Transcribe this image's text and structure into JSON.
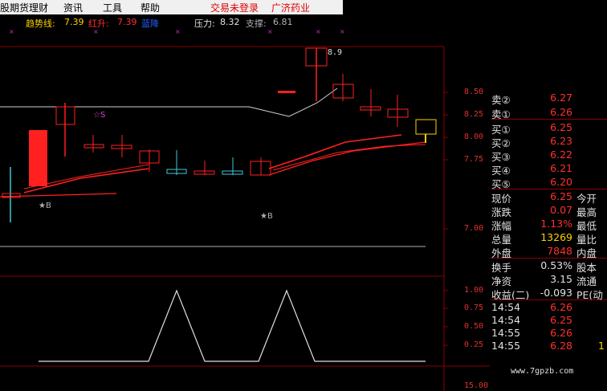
{
  "menubar": {
    "items": [
      "股期货理财",
      "资讯",
      "工具",
      "帮助"
    ],
    "login_status": "交易未登录",
    "stock_name": "广济药业"
  },
  "indicators": {
    "trend_label": "趋势线:",
    "trend_value": "7.39",
    "red_up_label": "红升:",
    "red_up_value": "7.39",
    "blue_down_label": "蓝降",
    "pressure_label": "压力:",
    "pressure_value": "8.32",
    "support_label": "支撑:",
    "support_value": "6.81"
  },
  "chart": {
    "price_labels": [
      "8.50",
      "8.25",
      "8.00",
      "7.75",
      "7.00"
    ],
    "osc_labels": [
      "1.00",
      "0.75",
      "0.50",
      "0.25"
    ],
    "volume_label": "15.00",
    "high_marker": "8.9",
    "signals": {
      "sell": "☆S",
      "buy1": "★B",
      "buy2": "★B"
    }
  },
  "quote": {
    "sell2": {
      "label": "卖②",
      "price": "6.27"
    },
    "sell1": {
      "label": "卖①",
      "price": "6.26"
    },
    "buys": [
      {
        "label": "买①",
        "price": "6.25"
      },
      {
        "label": "买②",
        "price": "6.23"
      },
      {
        "label": "买③",
        "price": "6.22"
      },
      {
        "label": "买④",
        "price": "6.21"
      },
      {
        "label": "买⑤",
        "price": "6.20"
      }
    ],
    "stats": [
      {
        "label": "现价",
        "value": "6.25",
        "right": "今开"
      },
      {
        "label": "涨跌",
        "value": "0.07",
        "right": "最高"
      },
      {
        "label": "涨幅",
        "value": "1.13%",
        "right": "最低"
      },
      {
        "label": "总量",
        "value": "13269",
        "right": "量比"
      },
      {
        "label": "外盘",
        "value": "7848",
        "right": "内盘"
      }
    ],
    "fundamentals": [
      {
        "label": "换手",
        "value": "0.53%",
        "right": "股本"
      },
      {
        "label": "净资",
        "value": "3.15",
        "right": "流通"
      },
      {
        "label": "收益(二)",
        "value": "-0.093",
        "right": "PE(动"
      }
    ],
    "ticks": [
      {
        "time": "14:54",
        "price": "6.26",
        "vol": ""
      },
      {
        "time": "14:54",
        "price": "6.25",
        "vol": ""
      },
      {
        "time": "14:55",
        "price": "6.26",
        "vol": ""
      },
      {
        "time": "14:55",
        "price": "6.28",
        "vol": "1"
      }
    ]
  },
  "watermark": "www.7gpzb.com",
  "colors": {
    "up": "#ff2020",
    "down": "#40c8d8",
    "panel_label": "#e0e0e0",
    "number": "#ff3030",
    "volume": "#ffd000"
  }
}
